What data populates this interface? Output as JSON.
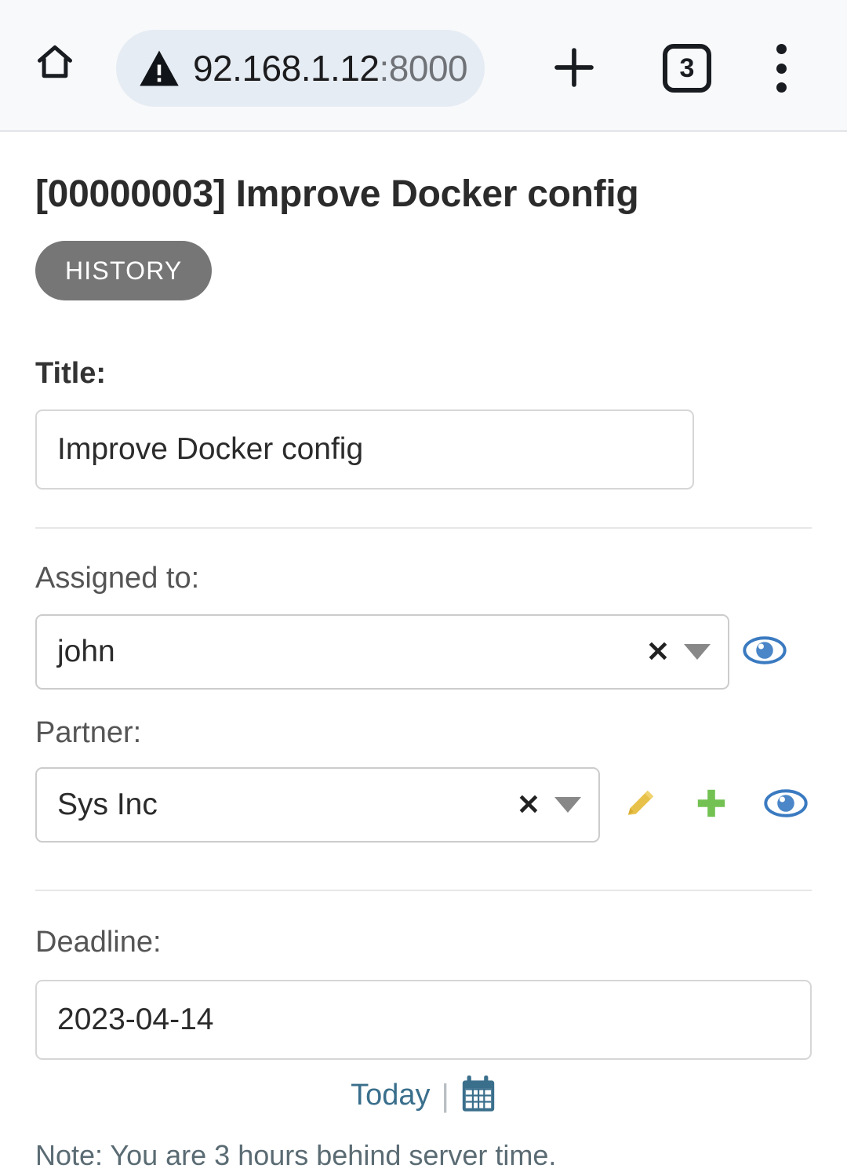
{
  "browser": {
    "home_icon": "home-icon",
    "warning_icon": "warning-triangle-icon",
    "url_host": "92.168.1.12",
    "url_port": ":8000",
    "new_tab_icon": "plus-icon",
    "tab_count": "3",
    "menu_icon": "overflow-menu-icon"
  },
  "page": {
    "title": "[00000003] Improve Docker config",
    "history_label": "HISTORY"
  },
  "form": {
    "title_field": {
      "label": "Title:",
      "value": "Improve Docker config",
      "placeholder": ""
    },
    "assigned_field": {
      "label": "Assigned to:",
      "value": "john",
      "clear_glyph": "✕",
      "view_icon": "eye-icon"
    },
    "partner_field": {
      "label": "Partner:",
      "value": "Sys Inc",
      "clear_glyph": "✕",
      "edit_icon": "pencil-icon",
      "add_icon": "plus-icon",
      "view_icon": "eye-icon"
    },
    "deadline_field": {
      "label": "Deadline:",
      "value": "2023-04-14",
      "today_label": "Today",
      "separator": "|",
      "calendar_icon": "calendar-icon",
      "note": "Note: You are 3 hours behind server time."
    }
  },
  "colors": {
    "history_gray": "#767676",
    "eye_blue": "#3a7ac0",
    "pencil_yellow": "#e8c14a",
    "plus_green": "#73c152",
    "link_teal": "#3a6f8c",
    "border_gray": "#cccccc"
  }
}
